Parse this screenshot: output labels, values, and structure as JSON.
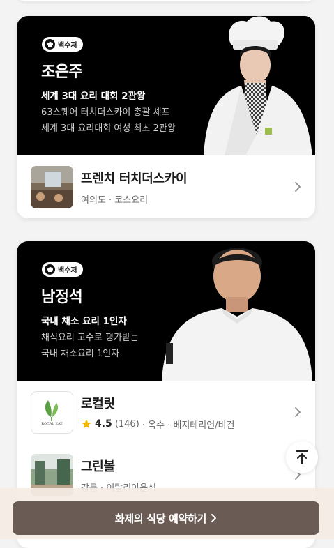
{
  "chefs": [
    {
      "badge": "백수저",
      "name": "조은주",
      "title": "세계 3대 요리 대회 2관왕",
      "desc1": "63스퀘어 터치더스카이 총괄 셰프",
      "desc2": "세계 3대 요리대회 여성 최초 2관왕",
      "restaurants": [
        {
          "name": "프렌치 터치더스카이",
          "meta": "여의도 · 코스요리"
        }
      ]
    },
    {
      "badge": "백수저",
      "name": "남정석",
      "title": "국내 채소 요리 1인자",
      "desc1": "채식요리 고수로 평가받는",
      "desc2": "국내 채소요리 1인자",
      "restaurants": [
        {
          "name": "로컬릿",
          "rating": "4.5",
          "reviews": "(146)",
          "meta": "· 옥수 · 베지테리언/비건",
          "logo_text": "ROCAL EAT"
        },
        {
          "name": "그린볼",
          "meta": "강릉 · 이탈리아음식"
        }
      ]
    }
  ],
  "cta": {
    "label": "화제의 식당 예약하기"
  },
  "colors": {
    "cta": "#6b5b55",
    "star": "#f5b400",
    "hero_bg": "#000000"
  }
}
